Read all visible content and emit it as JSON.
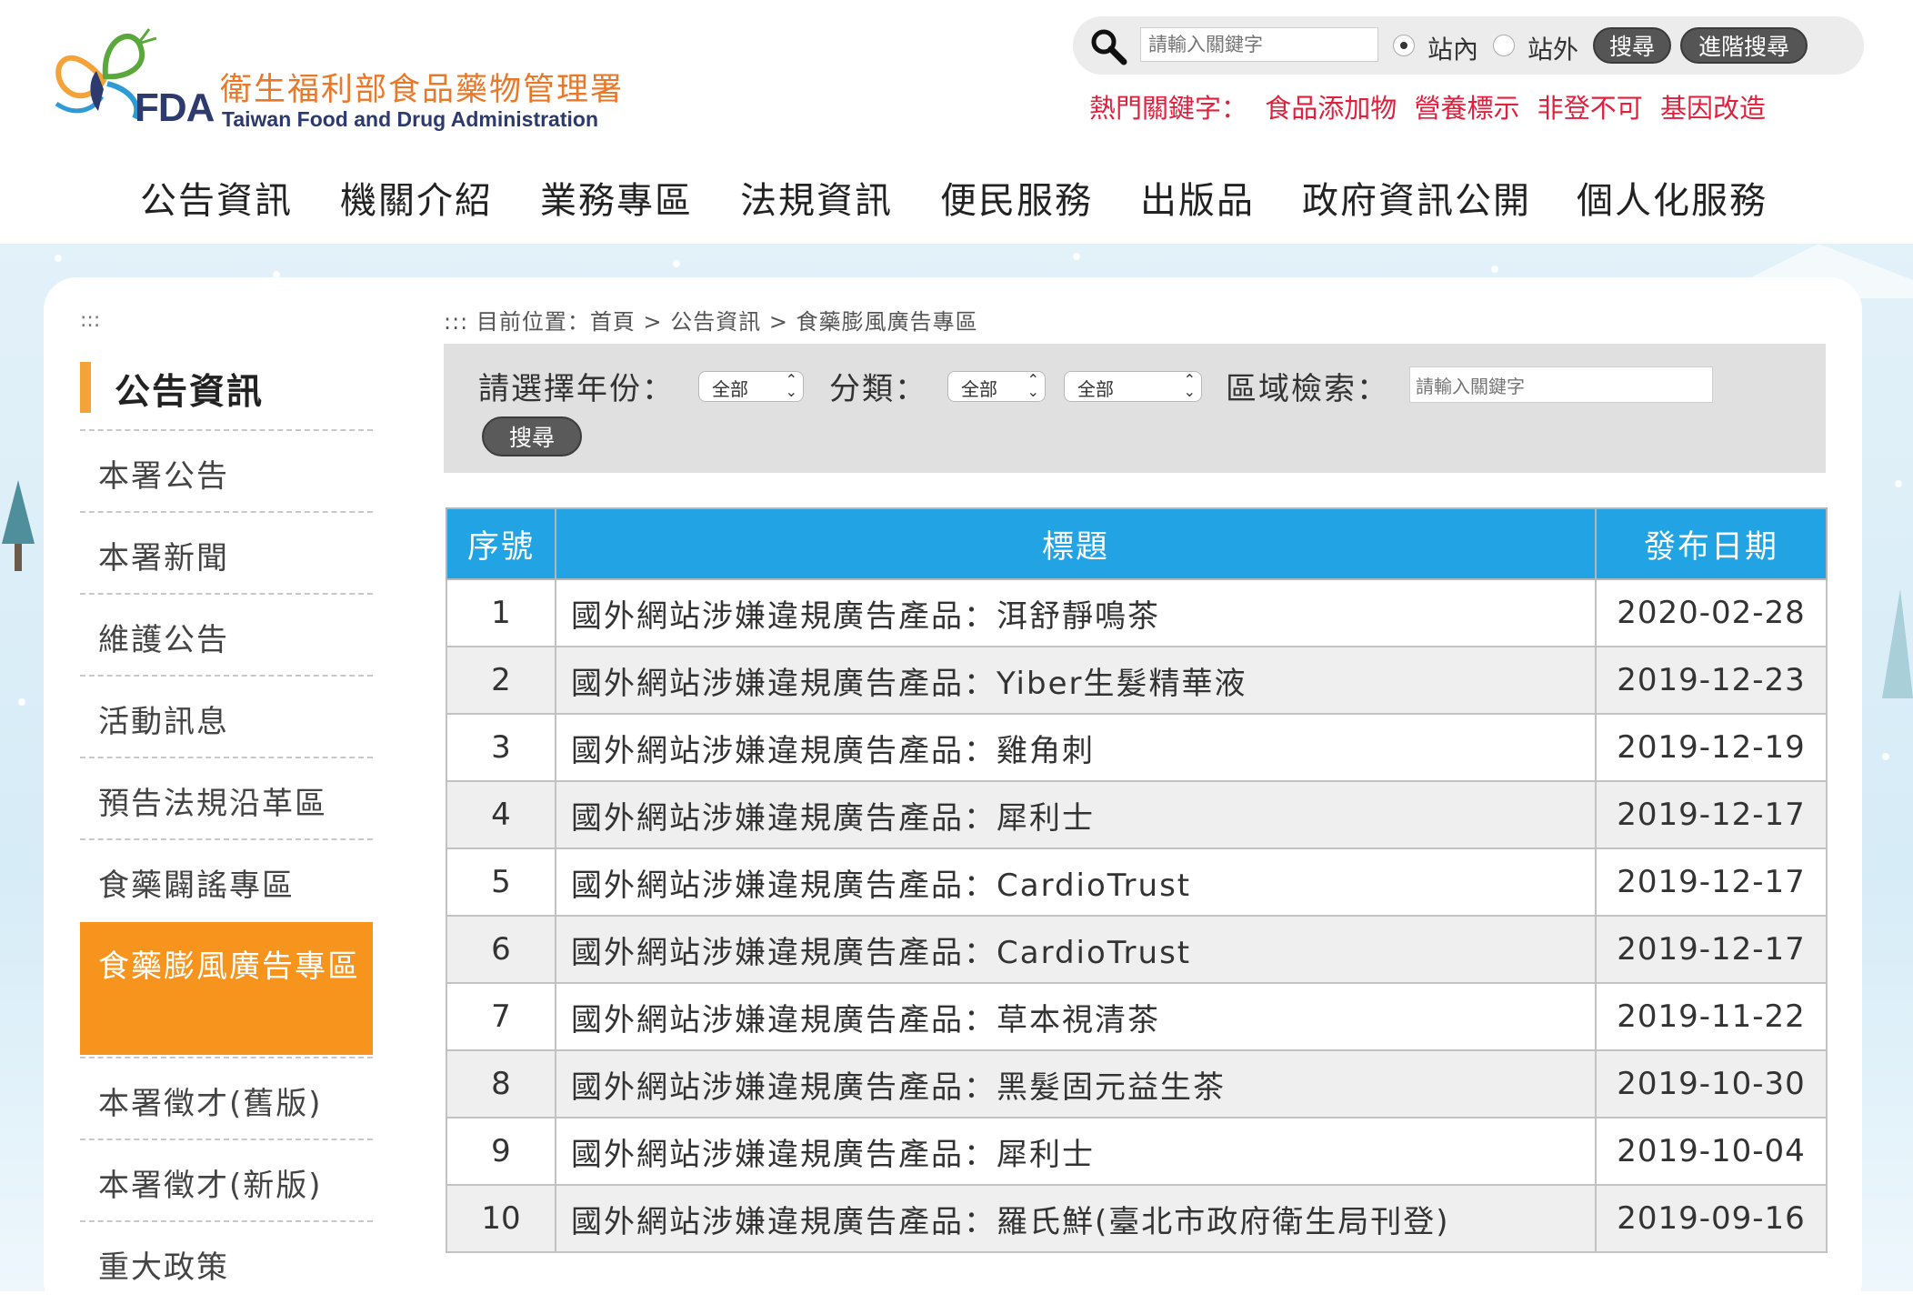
{
  "header": {
    "logo": {
      "mark": "FDA",
      "name_cn": "衛生福利部食品藥物管理署",
      "name_en": "Taiwan Food and Drug Administration"
    },
    "search": {
      "placeholder": "請輸入關鍵字",
      "scope_options": [
        "站內",
        "站外"
      ],
      "scope_selected": "站內",
      "search_label": "搜尋",
      "advanced_label": "進階搜尋"
    },
    "hot_keywords": {
      "label": "熱門關鍵字：",
      "items": [
        "食品添加物",
        "營養標示",
        "非登不可",
        "基因改造"
      ]
    }
  },
  "nav": {
    "items": [
      "公告資訊",
      "機關介紹",
      "業務專區",
      "法規資訊",
      "便民服務",
      "出版品",
      "政府資訊公開",
      "個人化服務"
    ]
  },
  "sidebar": {
    "marker": ":::",
    "title": "公告資訊",
    "items": [
      {
        "label": "本署公告"
      },
      {
        "label": "本署新聞"
      },
      {
        "label": "維護公告"
      },
      {
        "label": "活動訊息"
      },
      {
        "label": "預告法規沿革區"
      },
      {
        "label": "食藥闢謠專區"
      },
      {
        "label": "食藥膨風廣告專區",
        "active": true
      },
      {
        "label": "本署徵才(舊版)"
      },
      {
        "label": "本署徵才(新版)"
      },
      {
        "label": "重大政策"
      }
    ]
  },
  "breadcrumb": {
    "marker": ":::",
    "text": "目前位置：首頁 > 公告資訊 > 食藥膨風廣告專區"
  },
  "filter": {
    "year_label": "請選擇年份：",
    "year_value": "全部",
    "category_label": "分類：",
    "category_value_1": "全部",
    "category_value_2": "全部",
    "keyword_label": "區域檢索：",
    "keyword_placeholder": "請輸入關鍵字",
    "search_label": "搜尋"
  },
  "table": {
    "headers": {
      "no": "序號",
      "title": "標題",
      "date": "發布日期"
    },
    "rows": [
      {
        "no": "1",
        "title": "國外網站涉嫌違規廣告產品：洱舒靜鳴茶",
        "date": "2020-02-28"
      },
      {
        "no": "2",
        "title": "國外網站涉嫌違規廣告產品：Yiber生髮精華液",
        "date": "2019-12-23"
      },
      {
        "no": "3",
        "title": "國外網站涉嫌違規廣告產品：雞角刺",
        "date": "2019-12-19"
      },
      {
        "no": "4",
        "title": "國外網站涉嫌違規廣告產品：犀利士",
        "date": "2019-12-17"
      },
      {
        "no": "5",
        "title": "國外網站涉嫌違規廣告產品：CardioTrust",
        "date": "2019-12-17"
      },
      {
        "no": "6",
        "title": "國外網站涉嫌違規廣告產品：CardioTrust",
        "date": "2019-12-17"
      },
      {
        "no": "7",
        "title": "國外網站涉嫌違規廣告產品：草本視清茶",
        "date": "2019-11-22"
      },
      {
        "no": "8",
        "title": "國外網站涉嫌違規廣告產品：黑髮固元益生茶",
        "date": "2019-10-30"
      },
      {
        "no": "9",
        "title": "國外網站涉嫌違規廣告產品：犀利士",
        "date": "2019-10-04"
      },
      {
        "no": "10",
        "title": "國外網站涉嫌違規廣告產品：羅氏鮮(臺北市政府衛生局刊登)",
        "date": "2019-09-16"
      }
    ]
  },
  "colors": {
    "brand_orange": "#f7941d",
    "table_header_blue": "#22a3e4",
    "hot_keyword_red": "#e0203c",
    "logo_navy": "#2d3a6e"
  }
}
